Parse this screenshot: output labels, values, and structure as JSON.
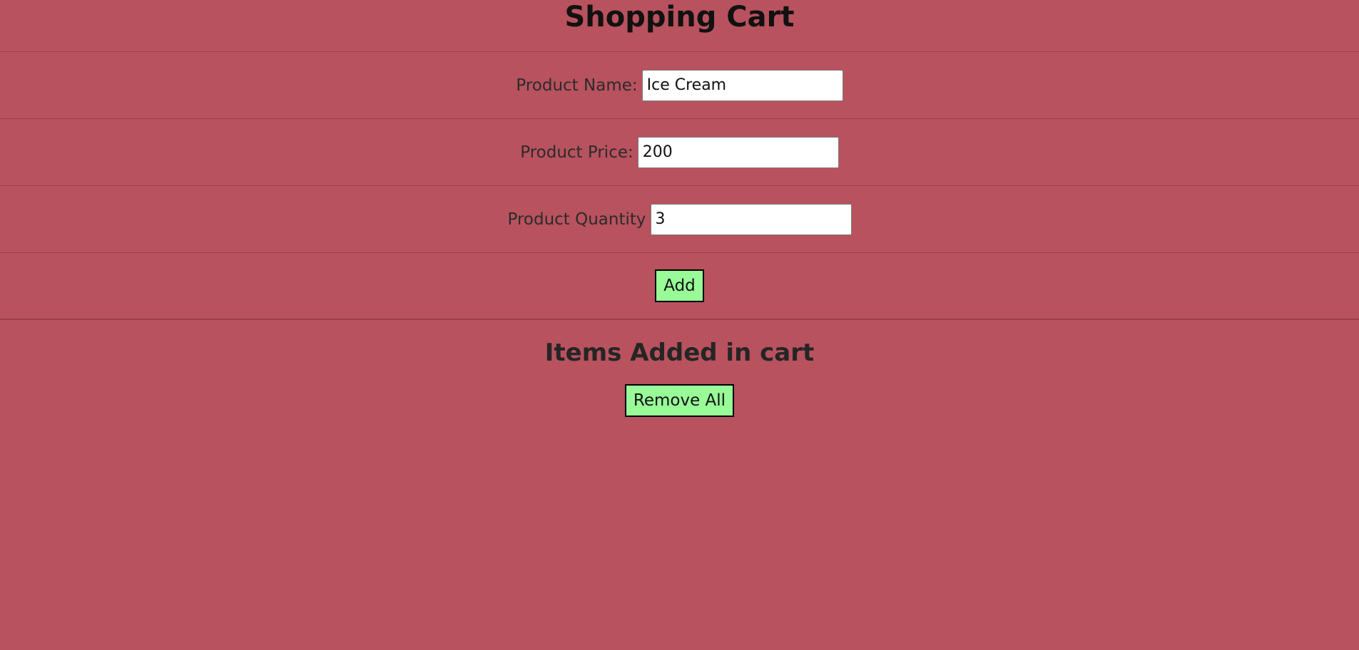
{
  "page": {
    "title": "Shopping Cart"
  },
  "form": {
    "name": {
      "label": "Product Name:",
      "value": "Ice Cream"
    },
    "price": {
      "label": "Product Price:",
      "value": "200"
    },
    "quantity": {
      "label": "Product Quantity",
      "value": "3"
    },
    "add_label": "Add"
  },
  "cart": {
    "heading": "Items Added in cart",
    "remove_all_label": "Remove All"
  },
  "colors": {
    "background": "#b8525e",
    "button": "#98fb98"
  }
}
